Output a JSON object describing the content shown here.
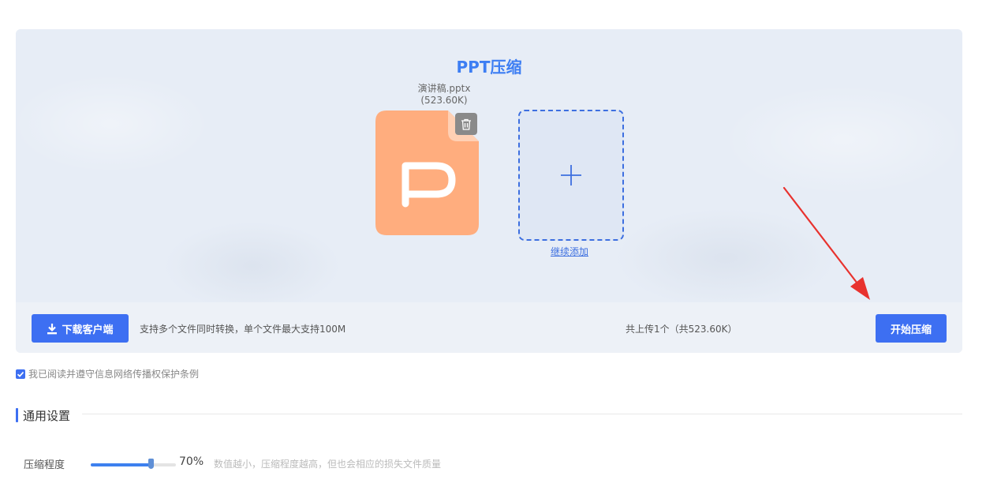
{
  "colors": {
    "accent": "#3d6ff2",
    "title": "#3d7ef3",
    "file_icon": "#ffad7e",
    "panel_bg": "#e7edf6",
    "arrow": "#e8322e"
  },
  "header": {
    "title": "PPT压缩"
  },
  "file": {
    "name": "演讲稿.pptx",
    "size": "(523.60K)",
    "icon": "ppt-file-icon",
    "delete_icon": "trash-icon"
  },
  "add": {
    "icon": "plus-icon",
    "link_label": "继续添加"
  },
  "toolbar": {
    "download_label": "下载客户端",
    "download_icon": "download-icon",
    "support_text": "支持多个文件同时转换，单个文件最大支持100M",
    "upload_count": "共上传1个（共523.60K）",
    "start_label": "开始压缩"
  },
  "agreement": {
    "label": "我已阅读并遵守信息网络传播权保护条例",
    "checked": true
  },
  "settings": {
    "section_title": "通用设置",
    "compression": {
      "label": "压缩程度",
      "value": 70,
      "value_text": "70%",
      "hint": "数值越小，压缩程度越高，但也会相应的损失文件质量"
    }
  }
}
